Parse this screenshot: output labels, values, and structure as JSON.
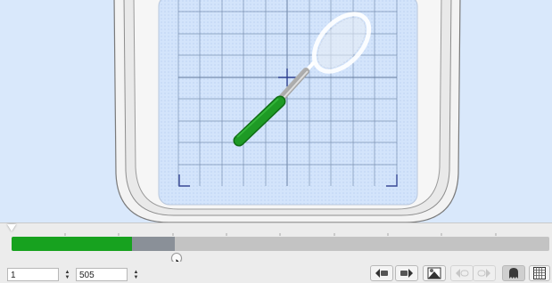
{
  "canvas": {
    "background": "#d9e8fb",
    "hoop_color": "#f2f2f2",
    "grid_color": "#7d93b3",
    "stitch_green": "#1e9a25"
  },
  "progress": {
    "completed_fraction": 0.2238,
    "preview_fraction": 0.3035,
    "done_color": "#17a21f",
    "preview_color": "#8a9098",
    "rest_color": "#c3c3c3"
  },
  "fields": {
    "start_stitch": "1",
    "end_stitch": "505"
  },
  "toolbar": {
    "buttons": [
      {
        "name": "prev-color-button",
        "icon": "rewind-needle-icon",
        "enabled": true
      },
      {
        "name": "next-color-button",
        "icon": "forward-needle-icon",
        "enabled": true
      },
      {
        "name": "stitch-view-button",
        "icon": "stitch-simulate-icon",
        "enabled": true
      },
      {
        "name": "prev-stitch-button",
        "icon": "step-back-icon",
        "enabled": false
      },
      {
        "name": "next-stitch-button",
        "icon": "step-forward-icon",
        "enabled": false
      },
      {
        "name": "ghost-button",
        "icon": "ghost-icon",
        "enabled": true
      },
      {
        "name": "pattern-grid-button",
        "icon": "grid-pattern-icon",
        "enabled": true
      }
    ]
  }
}
